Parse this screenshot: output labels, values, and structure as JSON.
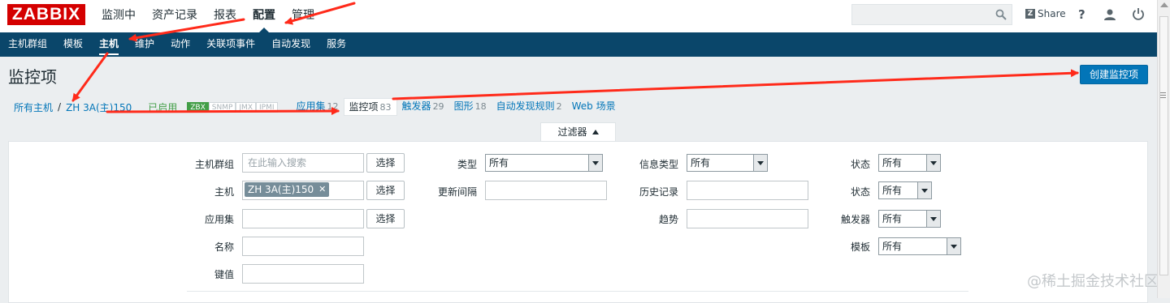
{
  "header": {
    "logo": "ZABBIX",
    "menu": [
      {
        "label": "监测中"
      },
      {
        "label": "资产记录"
      },
      {
        "label": "报表"
      },
      {
        "label": "配置"
      },
      {
        "label": "管理"
      }
    ],
    "share_label": "Share",
    "share_icon": "Z",
    "help_label": "?"
  },
  "nav": {
    "items": [
      {
        "label": "主机群组"
      },
      {
        "label": "模板"
      },
      {
        "label": "主机"
      },
      {
        "label": "维护"
      },
      {
        "label": "动作"
      },
      {
        "label": "关联项事件"
      },
      {
        "label": "自动发现"
      },
      {
        "label": "服务"
      }
    ]
  },
  "page": {
    "title": "监控项",
    "create_button": "创建监控项"
  },
  "breadcrumb": {
    "all_hosts": "所有主机",
    "sep": "/",
    "host": "ZH 3A(主)150",
    "status": "已启用",
    "tags": [
      "ZBX",
      "SNMP",
      "JMX",
      "IPMI"
    ],
    "tabs": [
      {
        "label": "应用集",
        "count": "12"
      },
      {
        "label": "监控项",
        "count": "83"
      },
      {
        "label": "触发器",
        "count": "29"
      },
      {
        "label": "图形",
        "count": "18"
      },
      {
        "label": "自动发现规则",
        "count": "2"
      },
      {
        "label": "Web 场景",
        "count": ""
      }
    ]
  },
  "filter": {
    "tab_label": "过滤器",
    "select_label": "选择",
    "col1": {
      "host_group_label": "主机群组",
      "host_group_placeholder": "在此输入搜索",
      "host_label": "主机",
      "host_chip": "ZH 3A(主)150",
      "app_label": "应用集",
      "name_label": "名称",
      "key_label": "键值"
    },
    "col2": {
      "type_label": "类型",
      "type_value": "所有",
      "interval_label": "更新间隔"
    },
    "col3": {
      "info_type_label": "信息类型",
      "info_type_value": "所有",
      "history_label": "历史记录",
      "trends_label": "趋势"
    },
    "col4": {
      "state_label": "状态",
      "state_value": "所有",
      "status_label": "状态",
      "status_value": "所有",
      "triggers_label": "触发器",
      "triggers_value": "所有",
      "template_label": "模板",
      "template_value": "所有"
    }
  },
  "watermark": "@稀土掘金技术社区",
  "colors": {
    "brand": "#d40000",
    "navbar": "#0a466a",
    "link": "#0275b8",
    "enabled": "#429e47",
    "annotation": "#ff2a1a"
  }
}
